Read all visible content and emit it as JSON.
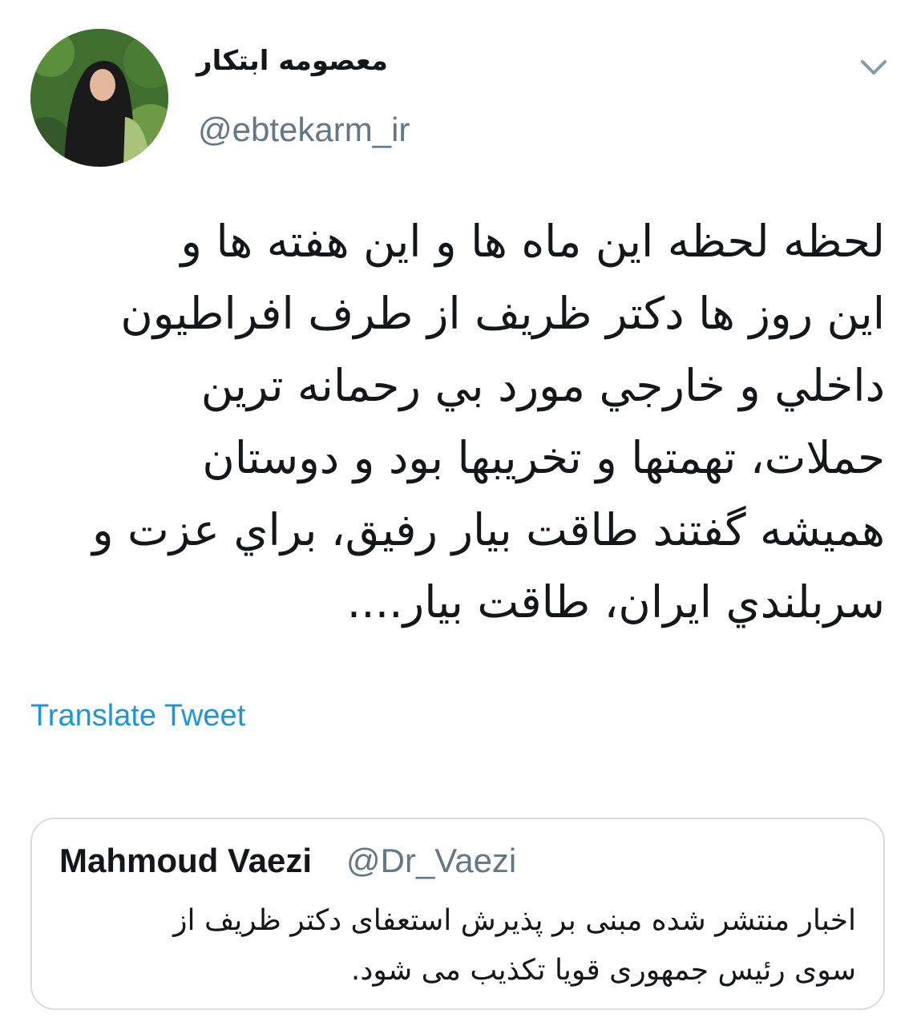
{
  "author": {
    "display_name": "معصومه ابتکار",
    "handle": "@ebtekarm_ir",
    "avatar_icon": "profile-photo"
  },
  "menu_icon": "chevron-down-icon",
  "tweet": {
    "lines": [
      "لحظه لحظه این ماه ها و این هفته ها و",
      "این روز ها دکتر ظریف از طرف افراطیون",
      "داخلي و خارجي مورد بي رحمانه ترین",
      "حملات، تهمتها و تخریبها بود و دوستان",
      "همیشه گفتند طاقت بیار رفیق، براي عزت و",
      "سربلندي ایران، طاقت بیار...."
    ]
  },
  "translate_label": "Translate Tweet",
  "quoted_tweet": {
    "author_name": "Mahmoud Vaezi",
    "author_handle": "@Dr_Vaezi",
    "lines": [
      "اخبار منتشر شده مبنی بر پذیرش استعفای دکتر ظریف از",
      "سوی رئیس جمهوری قویا تکذیب می شود."
    ]
  },
  "colors": {
    "text": "#14171a",
    "secondary_text": "#657786",
    "link": "#1b95e0",
    "border": "#d7dde2"
  }
}
